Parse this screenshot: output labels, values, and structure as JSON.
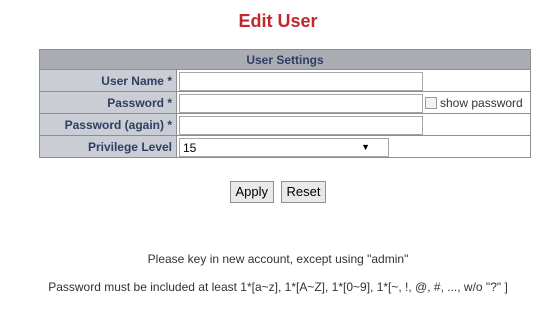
{
  "page": {
    "title": "Edit User",
    "section_title": "User Settings"
  },
  "form": {
    "username_label": "User Name *",
    "username_value": "",
    "password_label": "Password *",
    "password_value": "",
    "show_password_label": "show password",
    "password_again_label": "Password (again) *",
    "password_again_value": "",
    "privilege_label": "Privilege Level",
    "privilege_value": "15"
  },
  "buttons": {
    "apply": "Apply",
    "reset": "Reset"
  },
  "notes": {
    "line1": "Please key in new account, except using \"admin\"",
    "line2": "Password must be included at least 1*[a~z], 1*[A~Z], 1*[0~9], 1*[~, !, @, #, ..., w/o \"?\" ]"
  }
}
